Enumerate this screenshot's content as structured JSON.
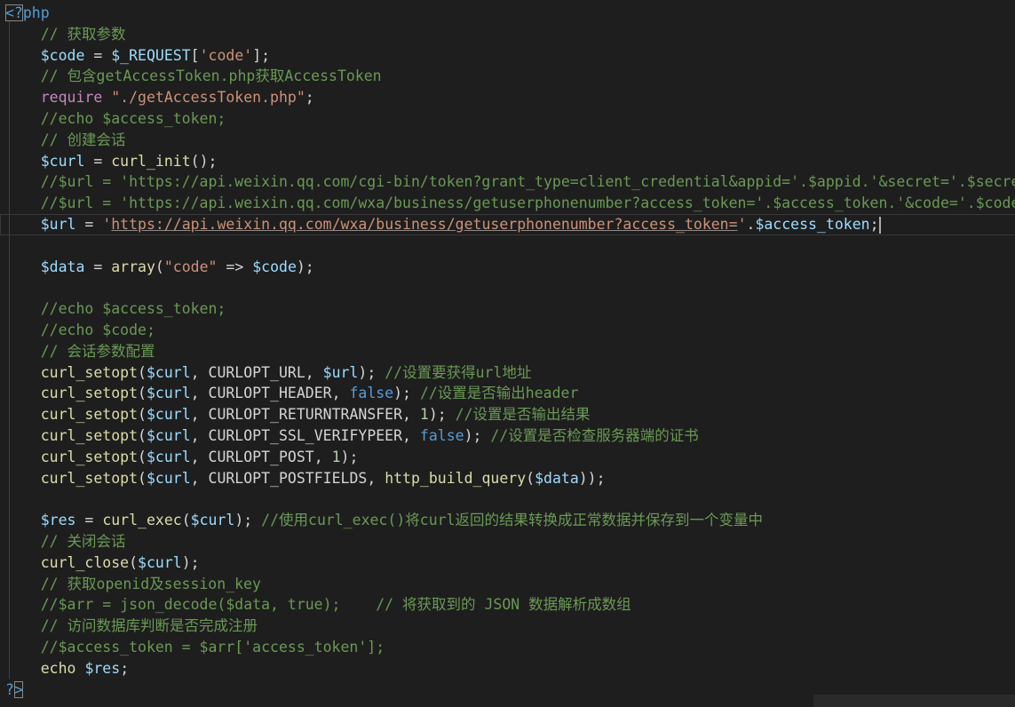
{
  "editor": {
    "language": "php",
    "lines": [
      [
        {
          "t": "<?",
          "c": "tg bracket-box"
        },
        {
          "t": "php",
          "c": "tg"
        }
      ],
      [
        {
          "t": "    // 获取参数",
          "c": "cm"
        }
      ],
      [
        {
          "t": "    ",
          "c": "pl"
        },
        {
          "t": "$code",
          "c": "vr"
        },
        {
          "t": " = ",
          "c": "pl"
        },
        {
          "t": "$_REQUEST",
          "c": "vr"
        },
        {
          "t": "[",
          "c": "pl"
        },
        {
          "t": "'code'",
          "c": "st"
        },
        {
          "t": "];",
          "c": "pl"
        }
      ],
      [
        {
          "t": "    // 包含getAccessToken.php获取AccessToken",
          "c": "cm"
        }
      ],
      [
        {
          "t": "    ",
          "c": "pl"
        },
        {
          "t": "require",
          "c": "kw"
        },
        {
          "t": " ",
          "c": "pl"
        },
        {
          "t": "\"./getAccessToken.php\"",
          "c": "st"
        },
        {
          "t": ";",
          "c": "pl"
        }
      ],
      [
        {
          "t": "    //echo $access_token;",
          "c": "cm"
        }
      ],
      [
        {
          "t": "    // 创建会话",
          "c": "cm"
        }
      ],
      [
        {
          "t": "    ",
          "c": "pl"
        },
        {
          "t": "$curl",
          "c": "vr"
        },
        {
          "t": " = ",
          "c": "pl"
        },
        {
          "t": "curl_init",
          "c": "fn"
        },
        {
          "t": "();",
          "c": "pl"
        }
      ],
      [
        {
          "t": "    //$url = 'https://api.weixin.qq.com/cgi-bin/token?grant_type=client_credential&appid='.$appid.'&secret='.$secret;",
          "c": "cm"
        }
      ],
      [
        {
          "t": "    //$url = 'https://api.weixin.qq.com/wxa/business/getuserphonenumber?access_token='.$access_token.'&code='.$code;",
          "c": "cm"
        }
      ],
      [
        {
          "t": "    ",
          "c": "pl"
        },
        {
          "t": "$url",
          "c": "vr"
        },
        {
          "t": " = ",
          "c": "pl"
        },
        {
          "t": "'",
          "c": "st"
        },
        {
          "t": "https://api.weixin.qq.com/wxa/business/getuserphonenumber?access_token=",
          "c": "st ul"
        },
        {
          "t": "'",
          "c": "st"
        },
        {
          "t": ".",
          "c": "pl"
        },
        {
          "t": "$access_token",
          "c": "vr"
        },
        {
          "t": ";",
          "c": "pl"
        }
      ],
      [],
      [
        {
          "t": "    ",
          "c": "pl"
        },
        {
          "t": "$data",
          "c": "vr"
        },
        {
          "t": " = ",
          "c": "pl"
        },
        {
          "t": "array",
          "c": "fn"
        },
        {
          "t": "(",
          "c": "pl"
        },
        {
          "t": "\"code\"",
          "c": "st"
        },
        {
          "t": " => ",
          "c": "pl"
        },
        {
          "t": "$code",
          "c": "vr"
        },
        {
          "t": ");",
          "c": "pl"
        }
      ],
      [],
      [
        {
          "t": "    //echo $access_token;",
          "c": "cm"
        }
      ],
      [
        {
          "t": "    //echo $code;",
          "c": "cm"
        }
      ],
      [
        {
          "t": "    // 会话参数配置",
          "c": "cm"
        }
      ],
      [
        {
          "t": "    ",
          "c": "pl"
        },
        {
          "t": "curl_setopt",
          "c": "fn"
        },
        {
          "t": "(",
          "c": "pl"
        },
        {
          "t": "$curl",
          "c": "vr"
        },
        {
          "t": ", CURLOPT_URL, ",
          "c": "cn"
        },
        {
          "t": "$url",
          "c": "vr"
        },
        {
          "t": "); ",
          "c": "pl"
        },
        {
          "t": "//设置要获得url地址",
          "c": "cm"
        }
      ],
      [
        {
          "t": "    ",
          "c": "pl"
        },
        {
          "t": "curl_setopt",
          "c": "fn"
        },
        {
          "t": "(",
          "c": "pl"
        },
        {
          "t": "$curl",
          "c": "vr"
        },
        {
          "t": ", CURLOPT_HEADER, ",
          "c": "cn"
        },
        {
          "t": "false",
          "c": "bl"
        },
        {
          "t": "); ",
          "c": "pl"
        },
        {
          "t": "//设置是否输出header",
          "c": "cm"
        }
      ],
      [
        {
          "t": "    ",
          "c": "pl"
        },
        {
          "t": "curl_setopt",
          "c": "fn"
        },
        {
          "t": "(",
          "c": "pl"
        },
        {
          "t": "$curl",
          "c": "vr"
        },
        {
          "t": ", CURLOPT_RETURNTRANSFER, ",
          "c": "cn"
        },
        {
          "t": "1",
          "c": "nm"
        },
        {
          "t": "); ",
          "c": "pl"
        },
        {
          "t": "//设置是否输出结果",
          "c": "cm"
        }
      ],
      [
        {
          "t": "    ",
          "c": "pl"
        },
        {
          "t": "curl_setopt",
          "c": "fn"
        },
        {
          "t": "(",
          "c": "pl"
        },
        {
          "t": "$curl",
          "c": "vr"
        },
        {
          "t": ", CURLOPT_SSL_VERIFYPEER, ",
          "c": "cn"
        },
        {
          "t": "false",
          "c": "bl"
        },
        {
          "t": "); ",
          "c": "pl"
        },
        {
          "t": "//设置是否检查服务器端的证书",
          "c": "cm"
        }
      ],
      [
        {
          "t": "    ",
          "c": "pl"
        },
        {
          "t": "curl_setopt",
          "c": "fn"
        },
        {
          "t": "(",
          "c": "pl"
        },
        {
          "t": "$curl",
          "c": "vr"
        },
        {
          "t": ", CURLOPT_POST, ",
          "c": "cn"
        },
        {
          "t": "1",
          "c": "nm"
        },
        {
          "t": ");",
          "c": "pl"
        }
      ],
      [
        {
          "t": "    ",
          "c": "pl"
        },
        {
          "t": "curl_setopt",
          "c": "fn"
        },
        {
          "t": "(",
          "c": "pl"
        },
        {
          "t": "$curl",
          "c": "vr"
        },
        {
          "t": ", CURLOPT_POSTFIELDS, ",
          "c": "cn"
        },
        {
          "t": "http_build_query",
          "c": "fn"
        },
        {
          "t": "(",
          "c": "pl"
        },
        {
          "t": "$data",
          "c": "vr"
        },
        {
          "t": "));",
          "c": "pl"
        }
      ],
      [],
      [
        {
          "t": "    ",
          "c": "pl"
        },
        {
          "t": "$res",
          "c": "vr"
        },
        {
          "t": " = ",
          "c": "pl"
        },
        {
          "t": "curl_exec",
          "c": "fn"
        },
        {
          "t": "(",
          "c": "pl"
        },
        {
          "t": "$curl",
          "c": "vr"
        },
        {
          "t": "); ",
          "c": "pl"
        },
        {
          "t": "//使用curl_exec()将curl返回的结果转换成正常数据并保存到一个变量中",
          "c": "cm"
        }
      ],
      [
        {
          "t": "    // 关闭会话",
          "c": "cm"
        }
      ],
      [
        {
          "t": "    ",
          "c": "pl"
        },
        {
          "t": "curl_close",
          "c": "fn"
        },
        {
          "t": "(",
          "c": "pl"
        },
        {
          "t": "$curl",
          "c": "vr"
        },
        {
          "t": ");",
          "c": "pl"
        }
      ],
      [
        {
          "t": "    // 获取openid及session_key",
          "c": "cm"
        }
      ],
      [
        {
          "t": "    //$arr = json_decode($data, true);    // 将获取到的 JSON 数据解析成数组",
          "c": "cm"
        }
      ],
      [
        {
          "t": "    // 访问数据库判断是否完成注册",
          "c": "cm"
        }
      ],
      [
        {
          "t": "    //$access_token = $arr['access_token'];",
          "c": "cm"
        }
      ],
      [
        {
          "t": "    ",
          "c": "pl"
        },
        {
          "t": "echo",
          "c": "fn"
        },
        {
          "t": " ",
          "c": "pl"
        },
        {
          "t": "$res",
          "c": "vr"
        },
        {
          "t": ";",
          "c": "pl"
        }
      ],
      [
        {
          "t": "?",
          "c": "tg"
        },
        {
          "t": ">",
          "c": "tg bracket-box"
        }
      ]
    ],
    "active_line_index": 10
  }
}
